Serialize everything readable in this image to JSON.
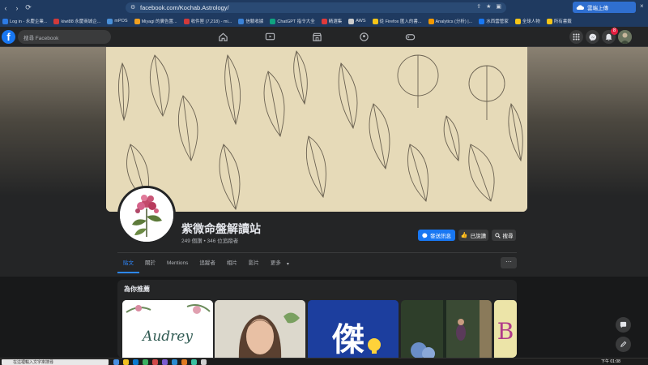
{
  "browser": {
    "url": "facebook.com/Kochab.Astrology/",
    "sync_label": "雲端上傳",
    "bookmarks": [
      {
        "label": "Log in - 永慶企業...",
        "color": "#2d7be5"
      },
      {
        "label": "kiwi88 永慶商城企...",
        "color": "#d23a3a"
      },
      {
        "label": "mPOS",
        "color": "#4a90d9"
      },
      {
        "label": "Miyagi 的廣告置...",
        "color": "#f0a020"
      },
      {
        "label": "收件匣 (7,218) - mi...",
        "color": "#d23a3a"
      },
      {
        "label": "信驗收據",
        "color": "#3b82d6"
      },
      {
        "label": "ChatGPT 指令大全",
        "color": "#10a37f"
      },
      {
        "label": "精選集",
        "color": "#e03a3a"
      },
      {
        "label": "AWS",
        "color": "#cccccc"
      },
      {
        "label": "從 Firefox 匯入的書...",
        "color": "#f5c518"
      },
      {
        "label": "Analytics (分析) |...",
        "color": "#f29900"
      },
      {
        "label": "水西雲管家",
        "color": "#1877f2"
      },
      {
        "label": "全球人物",
        "color": "#f5c518"
      },
      {
        "label": "所有書籤",
        "color": "#f5c518"
      }
    ]
  },
  "facebook": {
    "search_placeholder": "搜尋 Facebook",
    "notification_count": "8",
    "page": {
      "name": "紫微命盤解讀站",
      "stats": "249 個讚 • 346 位追蹤者",
      "buttons": {
        "message": "發送訊息",
        "liked": "已說讚",
        "search": "搜尋"
      },
      "tabs": [
        "貼文",
        "關於",
        "Mentions",
        "追蹤者",
        "相片",
        "影片",
        "更多"
      ],
      "active_tab": "貼文"
    },
    "recommendations": {
      "title": "為你推薦",
      "items": [
        "Audrey",
        "",
        "傑",
        "",
        "B"
      ]
    }
  },
  "taskbar": {
    "search_placeholder": "在這裡輸入文字來搜尋",
    "time": "下午 01:08"
  },
  "colors": {
    "fb_blue": "#1877f2",
    "fb_dark": "#242526",
    "fb_bg": "#18191a",
    "browser_bar": "#1f3a60"
  }
}
